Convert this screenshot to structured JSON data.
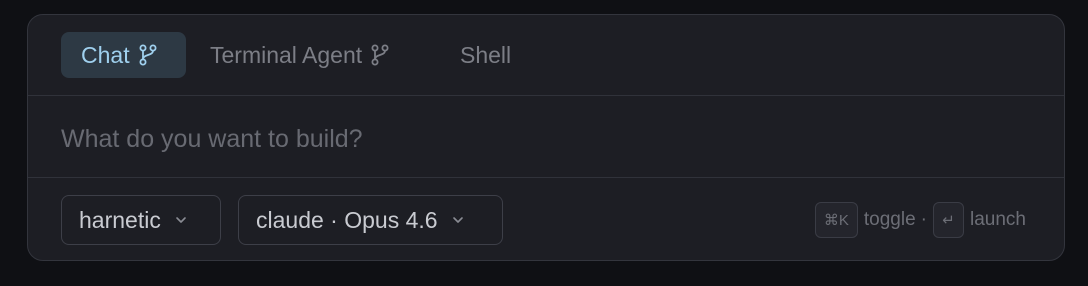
{
  "tabs": [
    {
      "label": "Chat",
      "active": true,
      "icon": "git-branch-icon"
    },
    {
      "label": "Terminal Agent",
      "active": false,
      "icon": "git-branch-icon"
    },
    {
      "label": "Shell",
      "active": false
    }
  ],
  "prompt": {
    "placeholder": "What do you want to build?",
    "value": ""
  },
  "selectors": {
    "workspace": "harnetic",
    "model": "claude · Opus 4.6"
  },
  "hints": {
    "toggle_key": "⌘K",
    "toggle_label": "toggle",
    "separator": "·",
    "launch_key": "↵",
    "launch_label": "launch"
  },
  "colors": {
    "background": "#0f1014",
    "panel": "#1d1e24",
    "active_tab_bg": "#2d3944",
    "active_tab_text": "#9fd0ee",
    "inactive_text": "#7c7e86"
  }
}
